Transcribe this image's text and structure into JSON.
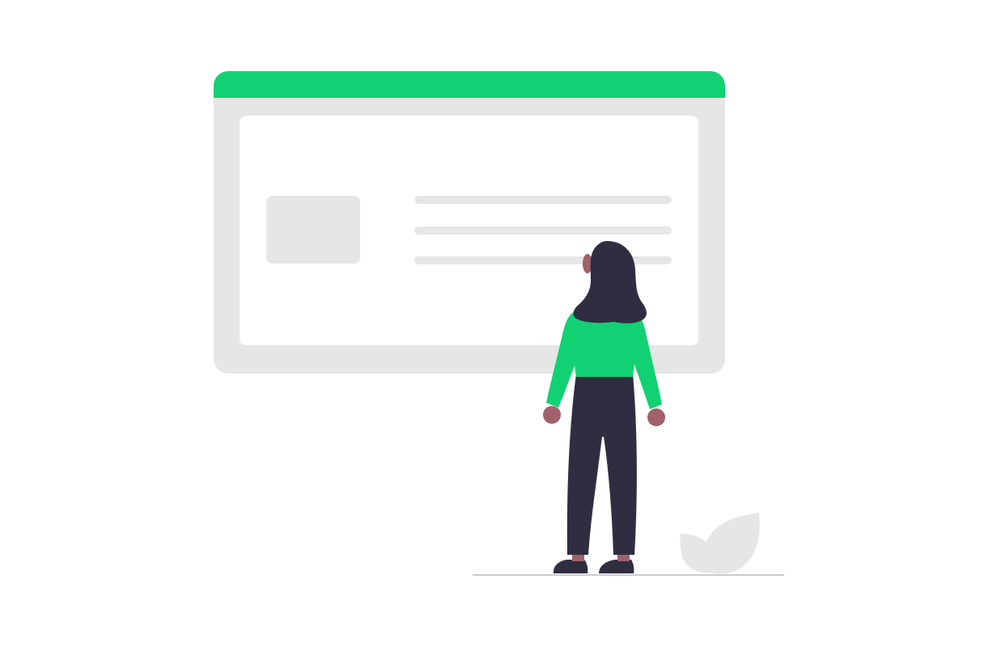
{
  "illustration": {
    "scene": "person-viewing-website-wireframe",
    "icons": [
      "browser-window-icon",
      "person-figure-icon",
      "leaf-plant-icon"
    ]
  },
  "colors": {
    "background": "#ffffff",
    "accent_green": "#12d172",
    "wireframe_gray": "#e6e6e6",
    "content_white": "#ffffff",
    "hair_dark": "#2f2e41",
    "pants_dark": "#2f2e41",
    "skin": "#a0616a",
    "ground_line": "#cccccc",
    "leaf_gray": "#e6e6e6"
  }
}
